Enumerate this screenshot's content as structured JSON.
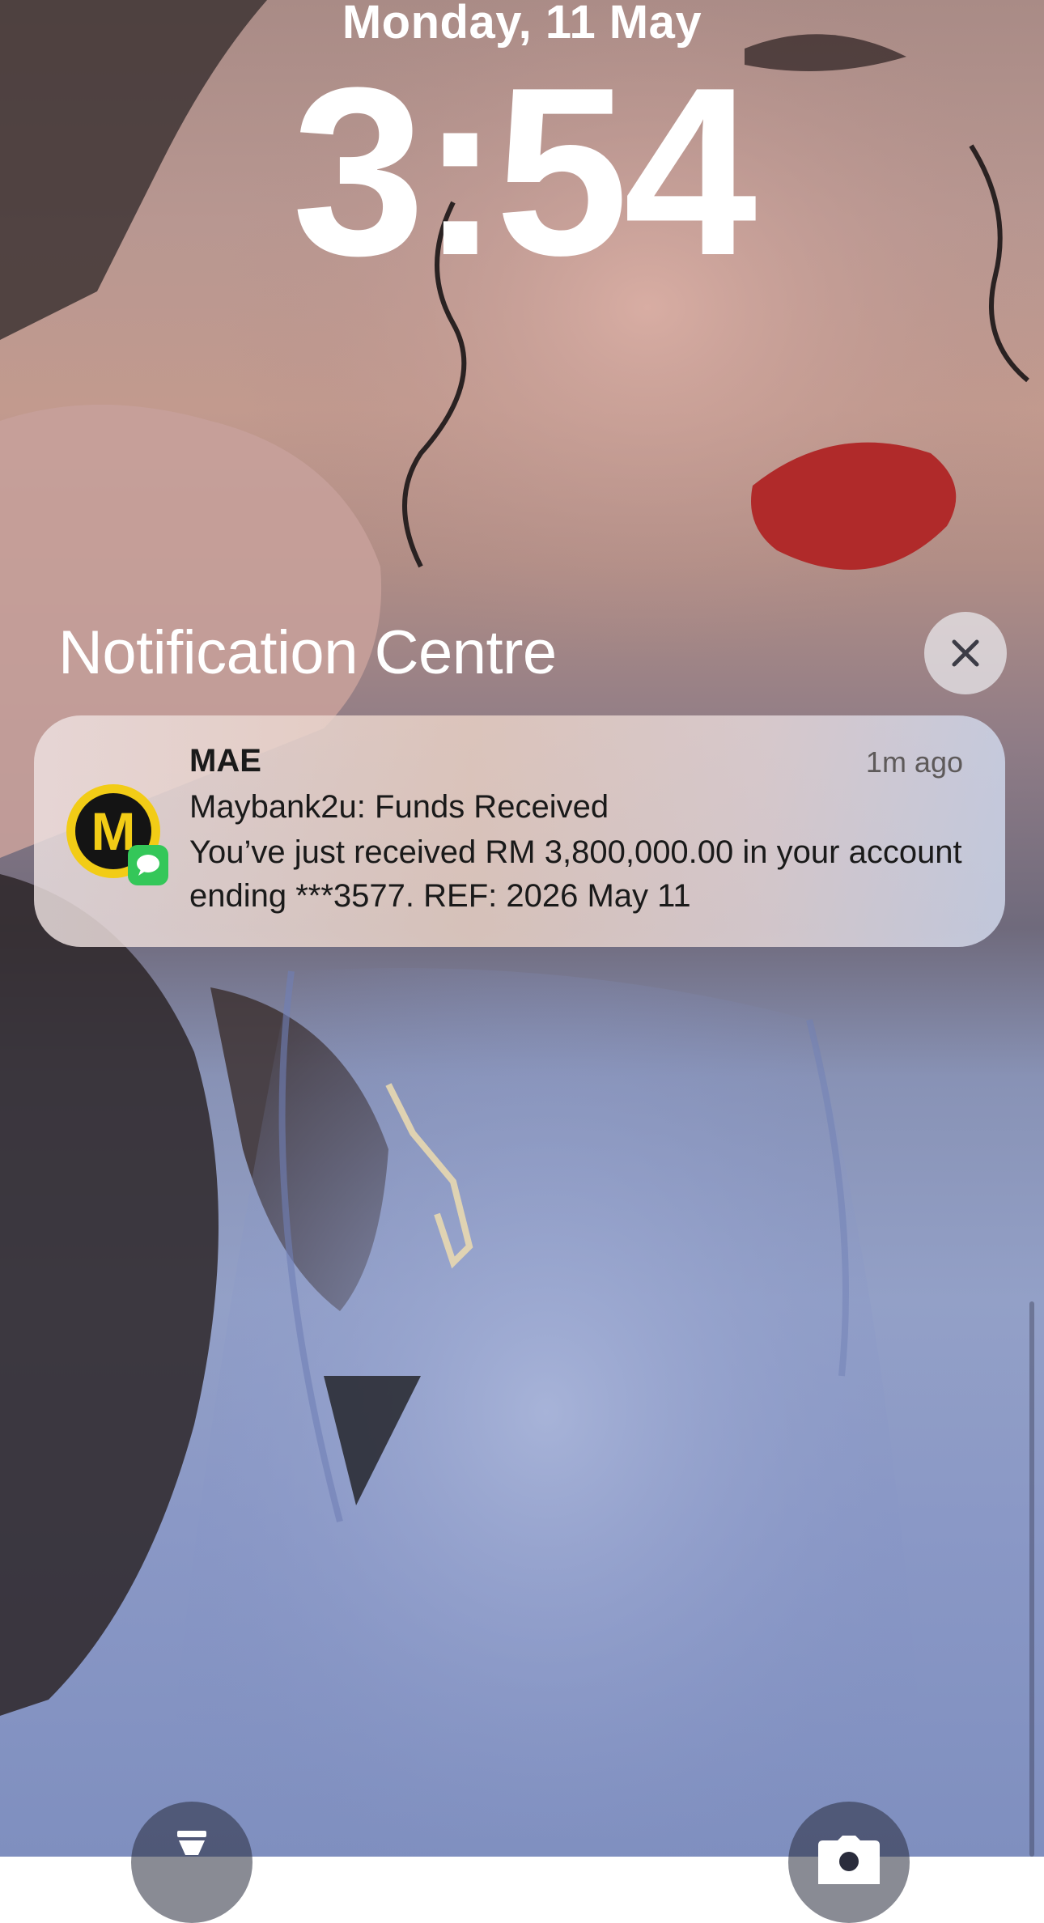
{
  "lock_screen": {
    "date": "Monday, 11 May",
    "time": "3:54"
  },
  "notification_centre": {
    "title": "Notification Centre",
    "close_icon": "close-icon"
  },
  "notification": {
    "app_name": "MAE",
    "time_ago": "1m ago",
    "title": "Maybank2u: Funds Received",
    "body": "You’ve just received RM 3,800,000.00 in your account ending ***3577. REF: 2026 May 11",
    "icon_letter": "M",
    "icon_color": "#f2cc16",
    "badge_icon": "messages-icon",
    "badge_color": "#34c759"
  },
  "quick_actions": {
    "left_icon": "flashlight-icon",
    "right_icon": "camera-icon"
  }
}
